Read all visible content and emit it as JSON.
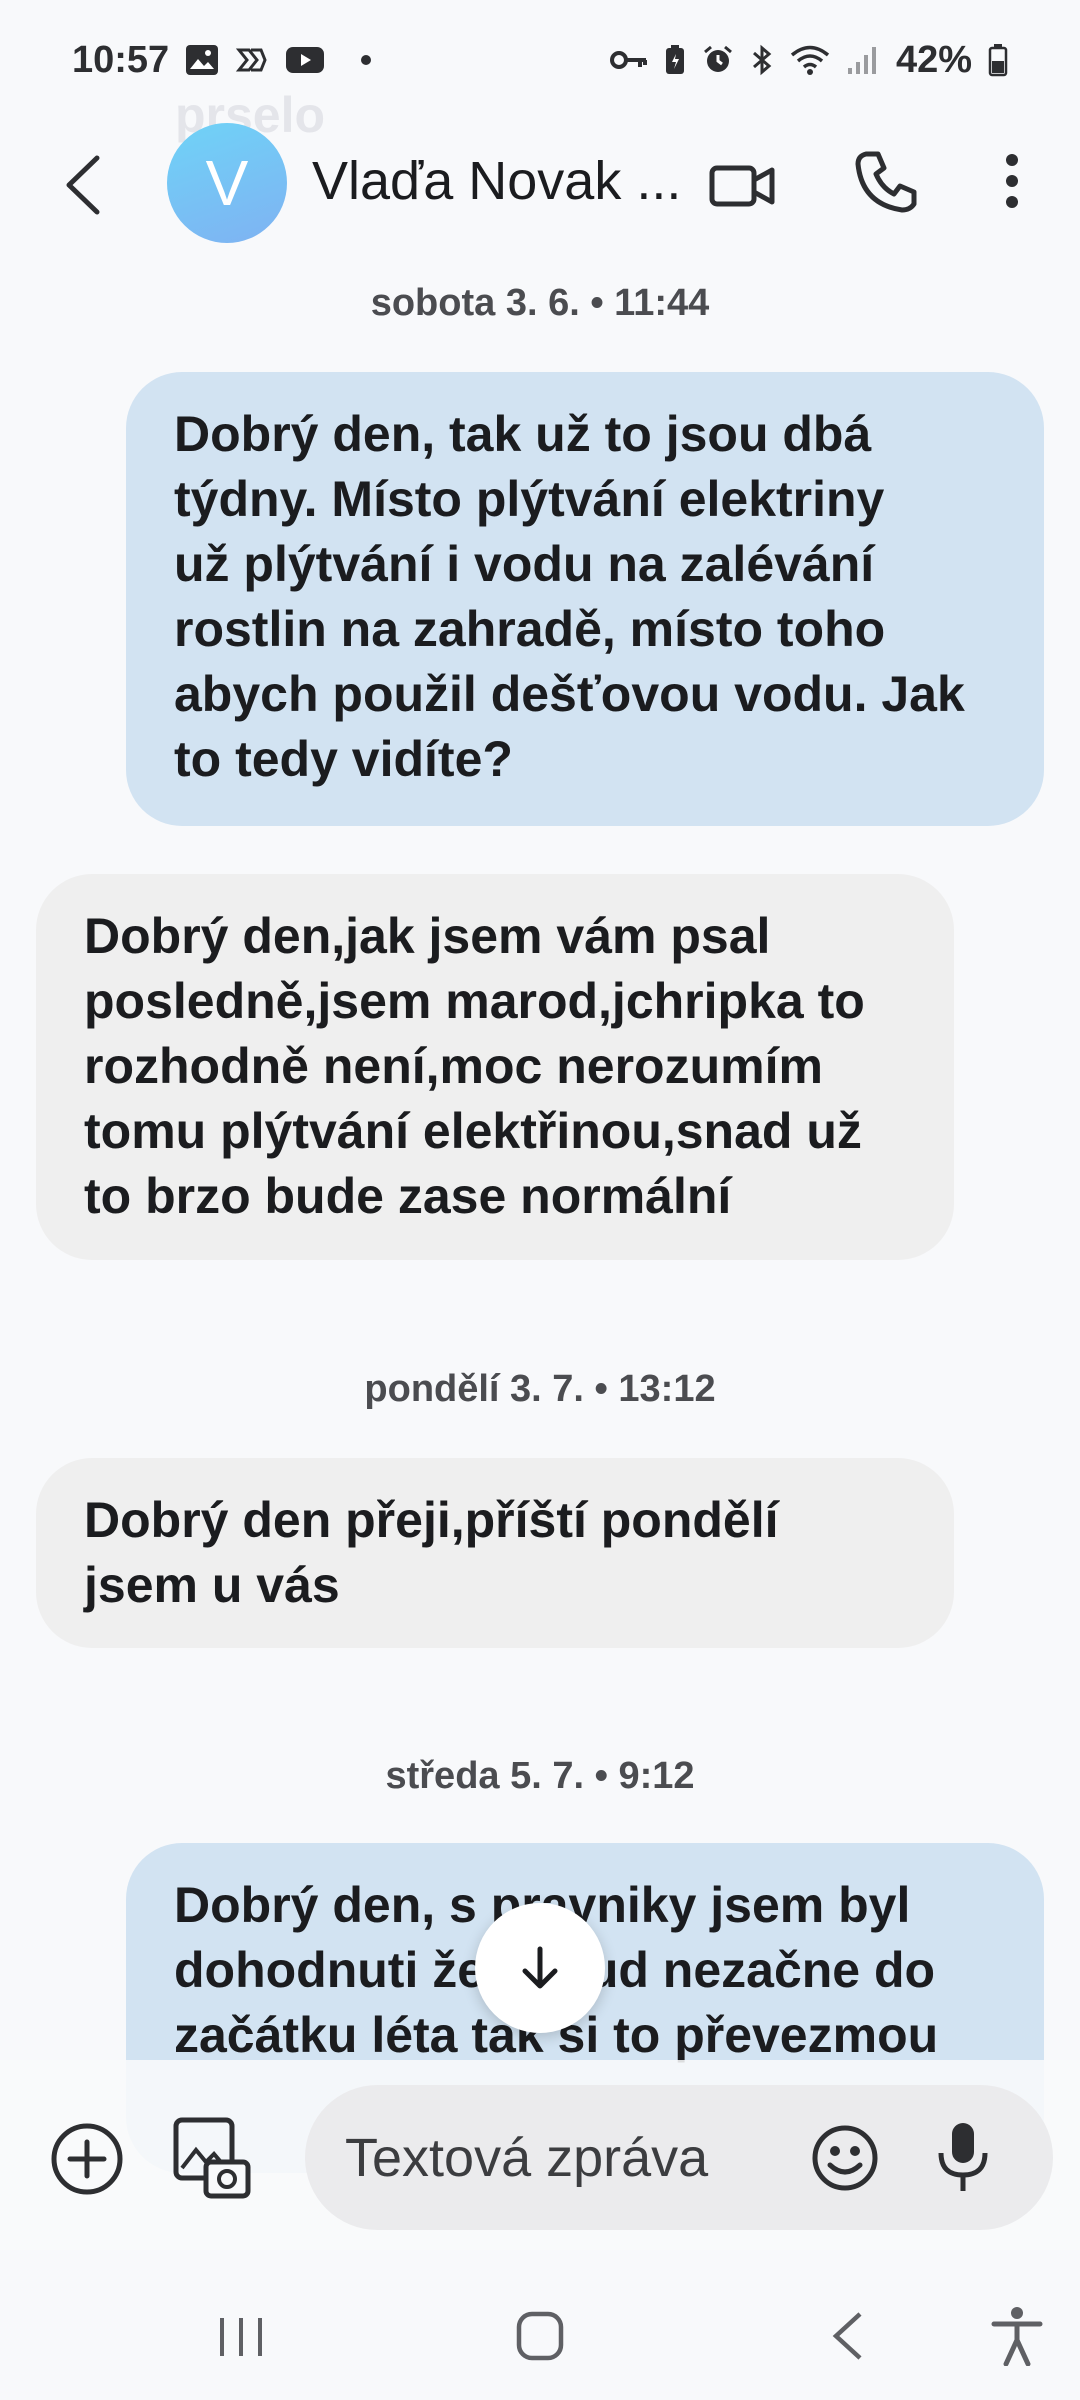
{
  "status_bar": {
    "time": "10:57",
    "battery": "42%",
    "left_icons": [
      "image-notification-icon",
      "app-notification-icon",
      "youtube-icon",
      "more-notifications-dot"
    ],
    "right_icons": [
      "vpn-key-icon",
      "battery-saver-icon",
      "alarm-icon",
      "bluetooth-icon",
      "wifi-icon",
      "signal-icon",
      "battery-icon"
    ]
  },
  "ghost_text": "prselo",
  "header": {
    "avatar_letter": "V",
    "contact_name": "Vlaďa Novak ...",
    "avatar_color": "#7fc8f5"
  },
  "conversation": {
    "dates": [
      "sobota 3. 6. • 11:44",
      "pondělí 3. 7. • 13:12",
      "středa 5. 7. • 9:12"
    ],
    "messages": [
      {
        "direction": "outgoing",
        "text": "Dobrý den,  tak už to jsou dbá\ntýdny. Místo plýtvání elektriny\nuž plýtvání i vodu na zalévání\nrostlin na zahradě, místo toho\nabych použil dešťovou vodu. Jak\nto tedy vidíte?"
      },
      {
        "direction": "incoming",
        "text": "Dobrý den,jak jsem vám psal\nposledně,jsem marod,jchripka to\nrozhodně není,moc nerozumím\ntomu plýtvání elektřinou,snad už\nto brzo bude zase normální"
      },
      {
        "direction": "incoming",
        "text": "Dobrý den přeji,příští pondělí\njsem u vás"
      },
      {
        "direction": "outgoing",
        "text": "Dobrý den,  s pravniky jsem byl\ndohodnuti že pokud nezačne do\nzačátku léta tak si to převezmou"
      }
    ]
  },
  "composer": {
    "placeholder": "Textová zpráva"
  },
  "colors": {
    "outgoing_bubble": "#d2e3f2",
    "incoming_bubble": "#efefef",
    "background": "#f8f9fb"
  }
}
